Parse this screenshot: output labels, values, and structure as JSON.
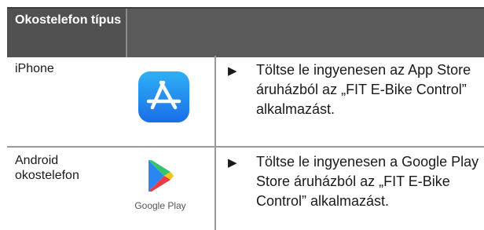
{
  "table": {
    "header": {
      "col1": "Okostelefon típus",
      "col2": ""
    },
    "rows": [
      {
        "device": "iPhone",
        "icon": "app-store-icon",
        "bullet": "▶",
        "instruction": "Töltse le ingyenesen az App Store áruházból az „FIT E-Bike Control” alkalmazást."
      },
      {
        "device": "Android okostelefon",
        "icon": "google-play-icon",
        "icon_caption": "Google Play",
        "bullet": "▶",
        "instruction": "Töltse le ingyenesen a Google Play Store áruházból az „FIT E-Bike Control” alkalmazást."
      }
    ]
  },
  "colors": {
    "header_bg": "#5a5a5a",
    "header_text": "#ffffff",
    "app_store_blue": "#1a6ee8"
  }
}
